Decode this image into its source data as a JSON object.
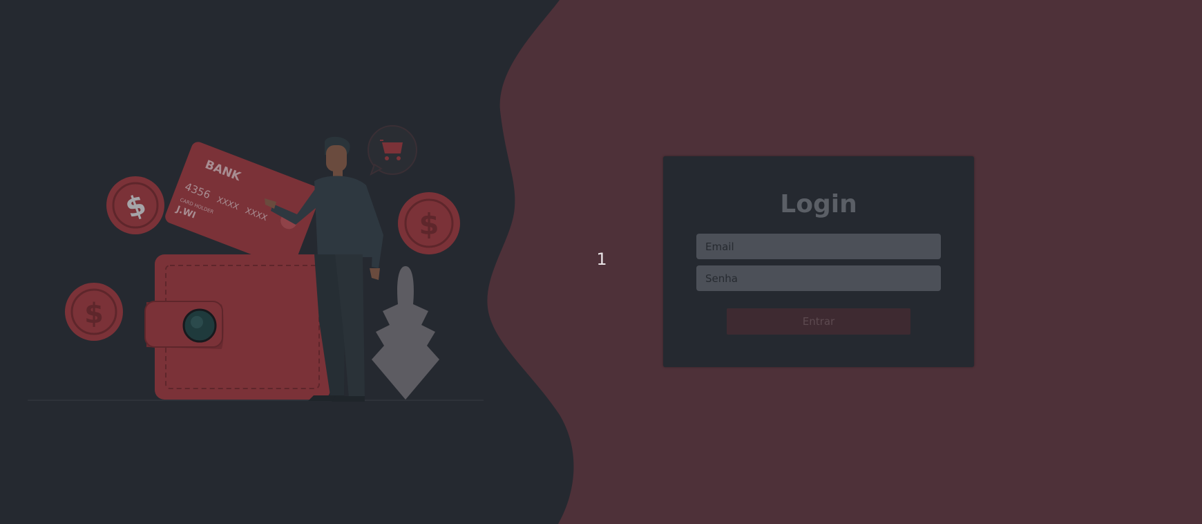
{
  "colors": {
    "background_right": "#4e3139",
    "background_left": "#252930",
    "accent": "#7b3238"
  },
  "slide_indicator": "1",
  "illustration": {
    "bank_card": {
      "bank_label": "BANK",
      "number_start": "4356",
      "number_mid": "XXXX",
      "number_end": "XXXX",
      "holder_label": "CARD HOLDER",
      "holder_name": "J.WI"
    },
    "coin_symbol": "$"
  },
  "login": {
    "title": "Login",
    "email_placeholder": "Email",
    "password_placeholder": "Senha",
    "submit_label": "Entrar"
  }
}
